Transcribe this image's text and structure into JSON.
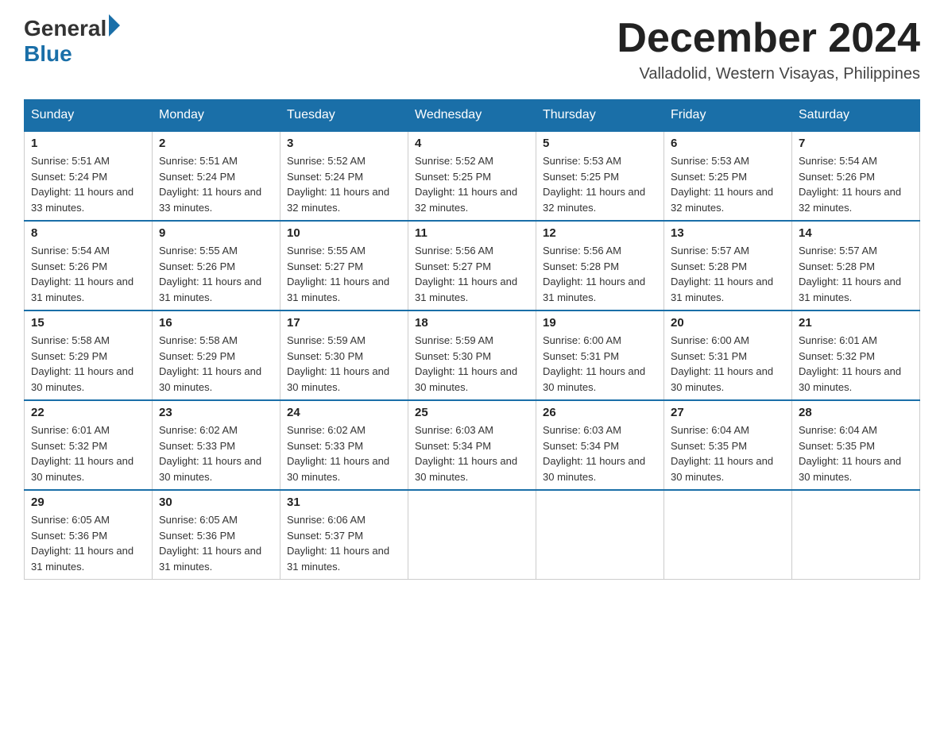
{
  "header": {
    "logo": {
      "general": "General",
      "blue": "Blue",
      "alt": "GeneralBlue logo"
    },
    "title": "December 2024",
    "location": "Valladolid, Western Visayas, Philippines"
  },
  "calendar": {
    "days_of_week": [
      "Sunday",
      "Monday",
      "Tuesday",
      "Wednesday",
      "Thursday",
      "Friday",
      "Saturday"
    ],
    "weeks": [
      [
        {
          "day": "1",
          "sunrise": "Sunrise: 5:51 AM",
          "sunset": "Sunset: 5:24 PM",
          "daylight": "Daylight: 11 hours and 33 minutes."
        },
        {
          "day": "2",
          "sunrise": "Sunrise: 5:51 AM",
          "sunset": "Sunset: 5:24 PM",
          "daylight": "Daylight: 11 hours and 33 minutes."
        },
        {
          "day": "3",
          "sunrise": "Sunrise: 5:52 AM",
          "sunset": "Sunset: 5:24 PM",
          "daylight": "Daylight: 11 hours and 32 minutes."
        },
        {
          "day": "4",
          "sunrise": "Sunrise: 5:52 AM",
          "sunset": "Sunset: 5:25 PM",
          "daylight": "Daylight: 11 hours and 32 minutes."
        },
        {
          "day": "5",
          "sunrise": "Sunrise: 5:53 AM",
          "sunset": "Sunset: 5:25 PM",
          "daylight": "Daylight: 11 hours and 32 minutes."
        },
        {
          "day": "6",
          "sunrise": "Sunrise: 5:53 AM",
          "sunset": "Sunset: 5:25 PM",
          "daylight": "Daylight: 11 hours and 32 minutes."
        },
        {
          "day": "7",
          "sunrise": "Sunrise: 5:54 AM",
          "sunset": "Sunset: 5:26 PM",
          "daylight": "Daylight: 11 hours and 32 minutes."
        }
      ],
      [
        {
          "day": "8",
          "sunrise": "Sunrise: 5:54 AM",
          "sunset": "Sunset: 5:26 PM",
          "daylight": "Daylight: 11 hours and 31 minutes."
        },
        {
          "day": "9",
          "sunrise": "Sunrise: 5:55 AM",
          "sunset": "Sunset: 5:26 PM",
          "daylight": "Daylight: 11 hours and 31 minutes."
        },
        {
          "day": "10",
          "sunrise": "Sunrise: 5:55 AM",
          "sunset": "Sunset: 5:27 PM",
          "daylight": "Daylight: 11 hours and 31 minutes."
        },
        {
          "day": "11",
          "sunrise": "Sunrise: 5:56 AM",
          "sunset": "Sunset: 5:27 PM",
          "daylight": "Daylight: 11 hours and 31 minutes."
        },
        {
          "day": "12",
          "sunrise": "Sunrise: 5:56 AM",
          "sunset": "Sunset: 5:28 PM",
          "daylight": "Daylight: 11 hours and 31 minutes."
        },
        {
          "day": "13",
          "sunrise": "Sunrise: 5:57 AM",
          "sunset": "Sunset: 5:28 PM",
          "daylight": "Daylight: 11 hours and 31 minutes."
        },
        {
          "day": "14",
          "sunrise": "Sunrise: 5:57 AM",
          "sunset": "Sunset: 5:28 PM",
          "daylight": "Daylight: 11 hours and 31 minutes."
        }
      ],
      [
        {
          "day": "15",
          "sunrise": "Sunrise: 5:58 AM",
          "sunset": "Sunset: 5:29 PM",
          "daylight": "Daylight: 11 hours and 30 minutes."
        },
        {
          "day": "16",
          "sunrise": "Sunrise: 5:58 AM",
          "sunset": "Sunset: 5:29 PM",
          "daylight": "Daylight: 11 hours and 30 minutes."
        },
        {
          "day": "17",
          "sunrise": "Sunrise: 5:59 AM",
          "sunset": "Sunset: 5:30 PM",
          "daylight": "Daylight: 11 hours and 30 minutes."
        },
        {
          "day": "18",
          "sunrise": "Sunrise: 5:59 AM",
          "sunset": "Sunset: 5:30 PM",
          "daylight": "Daylight: 11 hours and 30 minutes."
        },
        {
          "day": "19",
          "sunrise": "Sunrise: 6:00 AM",
          "sunset": "Sunset: 5:31 PM",
          "daylight": "Daylight: 11 hours and 30 minutes."
        },
        {
          "day": "20",
          "sunrise": "Sunrise: 6:00 AM",
          "sunset": "Sunset: 5:31 PM",
          "daylight": "Daylight: 11 hours and 30 minutes."
        },
        {
          "day": "21",
          "sunrise": "Sunrise: 6:01 AM",
          "sunset": "Sunset: 5:32 PM",
          "daylight": "Daylight: 11 hours and 30 minutes."
        }
      ],
      [
        {
          "day": "22",
          "sunrise": "Sunrise: 6:01 AM",
          "sunset": "Sunset: 5:32 PM",
          "daylight": "Daylight: 11 hours and 30 minutes."
        },
        {
          "day": "23",
          "sunrise": "Sunrise: 6:02 AM",
          "sunset": "Sunset: 5:33 PM",
          "daylight": "Daylight: 11 hours and 30 minutes."
        },
        {
          "day": "24",
          "sunrise": "Sunrise: 6:02 AM",
          "sunset": "Sunset: 5:33 PM",
          "daylight": "Daylight: 11 hours and 30 minutes."
        },
        {
          "day": "25",
          "sunrise": "Sunrise: 6:03 AM",
          "sunset": "Sunset: 5:34 PM",
          "daylight": "Daylight: 11 hours and 30 minutes."
        },
        {
          "day": "26",
          "sunrise": "Sunrise: 6:03 AM",
          "sunset": "Sunset: 5:34 PM",
          "daylight": "Daylight: 11 hours and 30 minutes."
        },
        {
          "day": "27",
          "sunrise": "Sunrise: 6:04 AM",
          "sunset": "Sunset: 5:35 PM",
          "daylight": "Daylight: 11 hours and 30 minutes."
        },
        {
          "day": "28",
          "sunrise": "Sunrise: 6:04 AM",
          "sunset": "Sunset: 5:35 PM",
          "daylight": "Daylight: 11 hours and 30 minutes."
        }
      ],
      [
        {
          "day": "29",
          "sunrise": "Sunrise: 6:05 AM",
          "sunset": "Sunset: 5:36 PM",
          "daylight": "Daylight: 11 hours and 31 minutes."
        },
        {
          "day": "30",
          "sunrise": "Sunrise: 6:05 AM",
          "sunset": "Sunset: 5:36 PM",
          "daylight": "Daylight: 11 hours and 31 minutes."
        },
        {
          "day": "31",
          "sunrise": "Sunrise: 6:06 AM",
          "sunset": "Sunset: 5:37 PM",
          "daylight": "Daylight: 11 hours and 31 minutes."
        },
        null,
        null,
        null,
        null
      ]
    ]
  }
}
